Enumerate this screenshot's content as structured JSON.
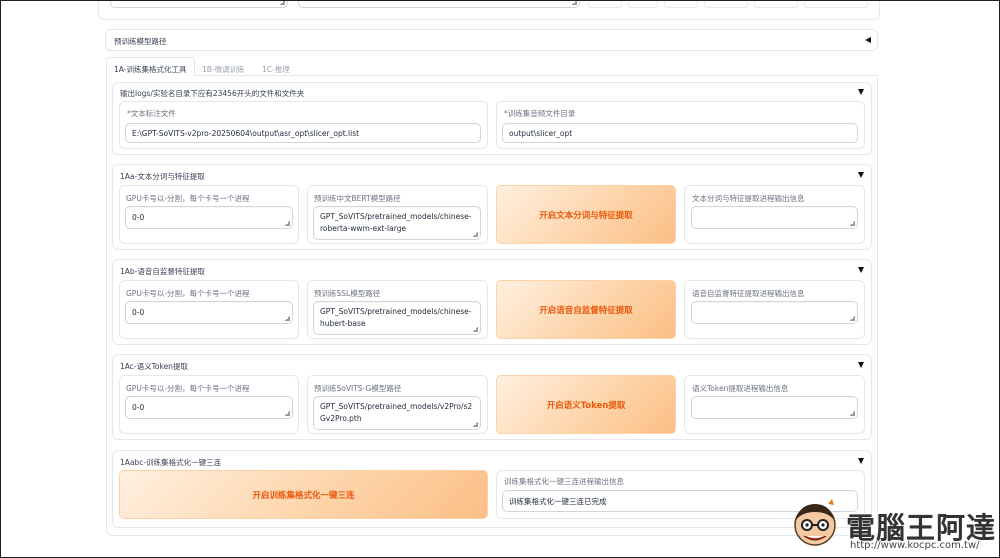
{
  "pretrained_section": {
    "title": "预训练模型路径"
  },
  "tabs": [
    {
      "label": "1A-训练集格式化工具"
    },
    {
      "label": "1B-微调训练"
    },
    {
      "label": "1C-推理"
    }
  ],
  "output_section": {
    "title": "输出logs/实验名目录下应有23456开头的文件和文件夹",
    "text_label_file": {
      "label": "*文本标注文件",
      "value": "E:\\GPT-SoVITS-v2pro-20250604\\output\\asr_opt\\slicer_opt.list"
    },
    "audio_dir": {
      "label": "*训练集音频文件目录",
      "value": "output\\slicer_opt"
    }
  },
  "section_1aa": {
    "title": "1Aa-文本分词与特征提取",
    "gpu": {
      "label": "GPU卡号以-分割，每个卡号一个进程",
      "value": "0-0"
    },
    "model": {
      "label": "预训练中文BERT模型路径",
      "value": "GPT_SoVITS/pretrained_models/chinese-roberta-wwm-ext-large"
    },
    "button": "开启文本分词与特征提取",
    "output": {
      "label": "文本分词与特征提取进程输出信息",
      "value": ""
    }
  },
  "section_1ab": {
    "title": "1Ab-语音自监督特征提取",
    "gpu": {
      "label": "GPU卡号以-分割，每个卡号一个进程",
      "value": "0-0"
    },
    "model": {
      "label": "预训练SSL模型路径",
      "value": "GPT_SoVITS/pretrained_models/chinese-hubert-base"
    },
    "button": "开启语音自监督特征提取",
    "output": {
      "label": "语音自监督特征提取进程输出信息",
      "value": ""
    }
  },
  "section_1ac": {
    "title": "1Ac-语义Token提取",
    "gpu": {
      "label": "GPU卡号以-分割，每个卡号一个进程",
      "value": "0-0"
    },
    "model": {
      "label": "预训练SoVITS-G模型路径",
      "value": "GPT_SoVITS/pretrained_models/v2Pro/s2Gv2Pro.pth"
    },
    "button": "开启语义Token提取",
    "output": {
      "label": "语义Token提取进程输出信息",
      "value": ""
    }
  },
  "section_1aabc": {
    "title": "1Aabc-训练集格式化一键三连",
    "button": "开启训练集格式化一键三连",
    "output": {
      "label": "训练集格式化一键三连进程输出信息",
      "value": "训练集格式化一键三连已完成"
    }
  },
  "watermark": {
    "brand": "電腦王阿達",
    "url": "http://www.kocpc.com.tw/"
  },
  "colors": {
    "accent": "#ea580c",
    "button_gradient_end": "#fbbf85",
    "border": "#e5e7eb"
  }
}
